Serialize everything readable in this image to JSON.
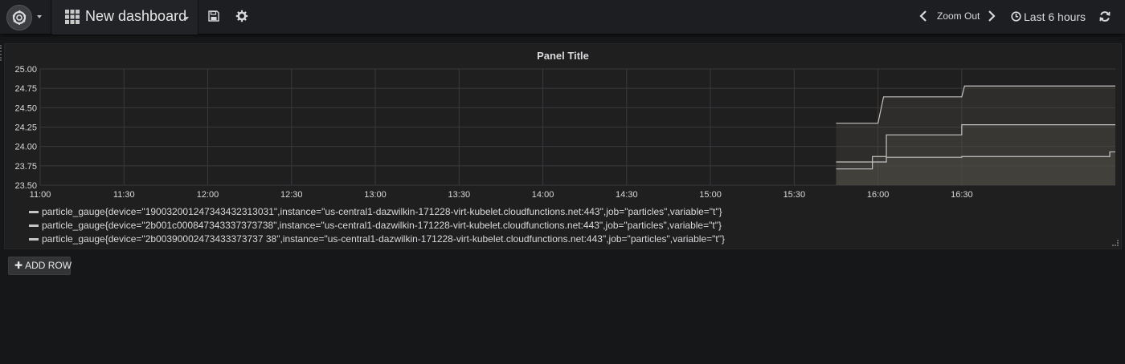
{
  "navbar": {
    "dashboard_title": "New dashboard",
    "zoom_out_label": "Zoom Out",
    "time_range_label": "Last 6 hours",
    "icons": [
      "grafana-logo-icon",
      "dashboard-grid-icon",
      "save-icon",
      "gear-icon",
      "chevron-left-icon",
      "chevron-right-icon",
      "clock-icon",
      "refresh-icon"
    ]
  },
  "panel": {
    "title": "Panel Title"
  },
  "add_row": {
    "label": "ADD ROW"
  },
  "colors": {
    "background": "#161719",
    "panel": "#1f1f20",
    "series": "#c4c4c4",
    "grid": "#3a3a3c",
    "fill": "#56524a"
  },
  "chart_data": {
    "type": "line",
    "title": "Panel Title",
    "xlabel": "",
    "ylabel": "",
    "ylim": [
      23.5,
      25.0
    ],
    "xlim": [
      "11:00",
      "17:25"
    ],
    "x_ticks": [
      "11:00",
      "11:30",
      "12:00",
      "12:30",
      "13:00",
      "13:30",
      "14:00",
      "14:30",
      "15:00",
      "15:30",
      "16:00",
      "16:30"
    ],
    "y_ticks": [
      "25.00",
      "24.75",
      "24.50",
      "24.25",
      "24.00",
      "23.75",
      "23.50"
    ],
    "grid": true,
    "legend_position": "bottom",
    "stack": true,
    "fill": true,
    "series": [
      {
        "name": "particle_gauge{device=\"190032001247343432313031\",instance=\"us-central1-dazwilkin-171228-virt-kubelet.cloudfunctions.net:443\",job=\"particles\",variable=\"t\"}",
        "points": [
          [
            "15:45",
            23.71
          ],
          [
            "15:58",
            23.71
          ],
          [
            "15:58",
            23.8
          ],
          [
            "16:03",
            23.8
          ],
          [
            "16:03",
            23.86
          ],
          [
            "16:30",
            23.86
          ],
          [
            "16:30",
            23.87
          ],
          [
            "17:23",
            23.87
          ],
          [
            "17:23",
            23.93
          ],
          [
            "17:25",
            23.93
          ]
        ]
      },
      {
        "name": "particle_gauge{device=\"2b001c000847343337373738\",instance=\"us-central1-dazwilkin-171228-virt-kubelet.cloudfunctions.net:443\",job=\"particles\",variable=\"t\"}",
        "points": [
          [
            "15:45",
            23.8
          ],
          [
            "15:58",
            23.8
          ],
          [
            "15:58",
            23.87
          ],
          [
            "16:03",
            23.87
          ],
          [
            "16:03",
            24.15
          ],
          [
            "16:30",
            24.15
          ],
          [
            "16:30",
            24.28
          ],
          [
            "17:25",
            24.28
          ]
        ]
      },
      {
        "name": "particle_gauge{device=\"2b00390002473433373737 38\",instance=\"us-central1-dazwilkin-171228-virt-kubelet.cloudfunctions.net:443\",job=\"particles\",variable=\"t\"}",
        "points": [
          [
            "15:45",
            24.3
          ],
          [
            "16:00",
            24.3
          ],
          [
            "16:02",
            24.64
          ],
          [
            "16:30",
            24.64
          ],
          [
            "16:31",
            24.78
          ],
          [
            "17:25",
            24.78
          ]
        ]
      }
    ]
  }
}
